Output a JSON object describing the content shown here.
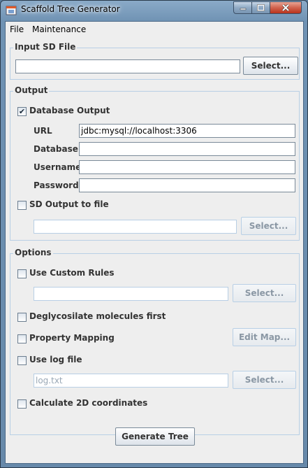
{
  "window": {
    "title": "Scaffold Tree Generator"
  },
  "menu": {
    "file": "File",
    "maintenance": "Maintenance"
  },
  "input_group": {
    "legend": "Input SD File",
    "path_value": "",
    "select_label": "Select..."
  },
  "output_group": {
    "legend": "Output",
    "db_output": {
      "label": "Database Output",
      "checked": true,
      "mark": "✔"
    },
    "url": {
      "label": "URL",
      "value": "jdbc:mysql://localhost:3306"
    },
    "database": {
      "label": "Database",
      "value": ""
    },
    "username": {
      "label": "Username",
      "value": ""
    },
    "password": {
      "label": "Password",
      "value": ""
    },
    "sd_output": {
      "label": "SD Output to file",
      "checked": false
    },
    "sd_output_path": "",
    "select_label": "Select..."
  },
  "options_group": {
    "legend": "Options",
    "custom_rules": {
      "label": "Use Custom Rules",
      "checked": false,
      "path": "",
      "select_label": "Select..."
    },
    "deglycosilate": {
      "label": "Deglycosilate molecules first",
      "checked": false
    },
    "property_mapping": {
      "label": "Property Mapping",
      "checked": false,
      "button_label": "Edit Map..."
    },
    "log_file": {
      "label": "Use log file",
      "checked": false,
      "path": "log.txt",
      "select_label": "Select..."
    },
    "calc_2d": {
      "label": "Calculate 2D coordinates",
      "checked": false
    }
  },
  "generate_label": "Generate Tree",
  "colors": {
    "frame": "#6f92b3",
    "client": "#eeeeee",
    "group_border": "#b8cfe5",
    "close_button": "#c8432b"
  },
  "icons": {
    "app": "app-window-icon",
    "minimize": "minimize-icon",
    "maximize": "maximize-icon",
    "close": "close-icon",
    "check": "checkmark-icon"
  }
}
